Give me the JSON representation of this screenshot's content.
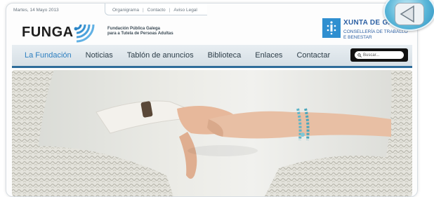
{
  "topbar": {
    "date": "Martes, 14 Mayo 2013",
    "links": [
      "Organigrama",
      "Contacto",
      "Aviso Legal"
    ],
    "separator": "|"
  },
  "header": {
    "logo": "FUNGA",
    "subtitle_line1": "Fundación Pública Galega",
    "subtitle_line2": "para a Tutela de Persoas Adultas",
    "xunta_name": "XUNTA DE GALICIA",
    "xunta_dept_line1": "CONSELLERÍA DE TRABALLO",
    "xunta_dept_line2": "E BENESTAR"
  },
  "nav": {
    "items": [
      "La Fundación",
      "Noticias",
      "Tablón de anuncios",
      "Biblioteca",
      "Enlaces",
      "Contactar"
    ],
    "active_index": 0,
    "search_placeholder": "Buscar..."
  },
  "colors": {
    "accent": "#2d7fc0",
    "nav_border": "#2e6c9a",
    "xunta_blue": "#2b5fa3"
  }
}
